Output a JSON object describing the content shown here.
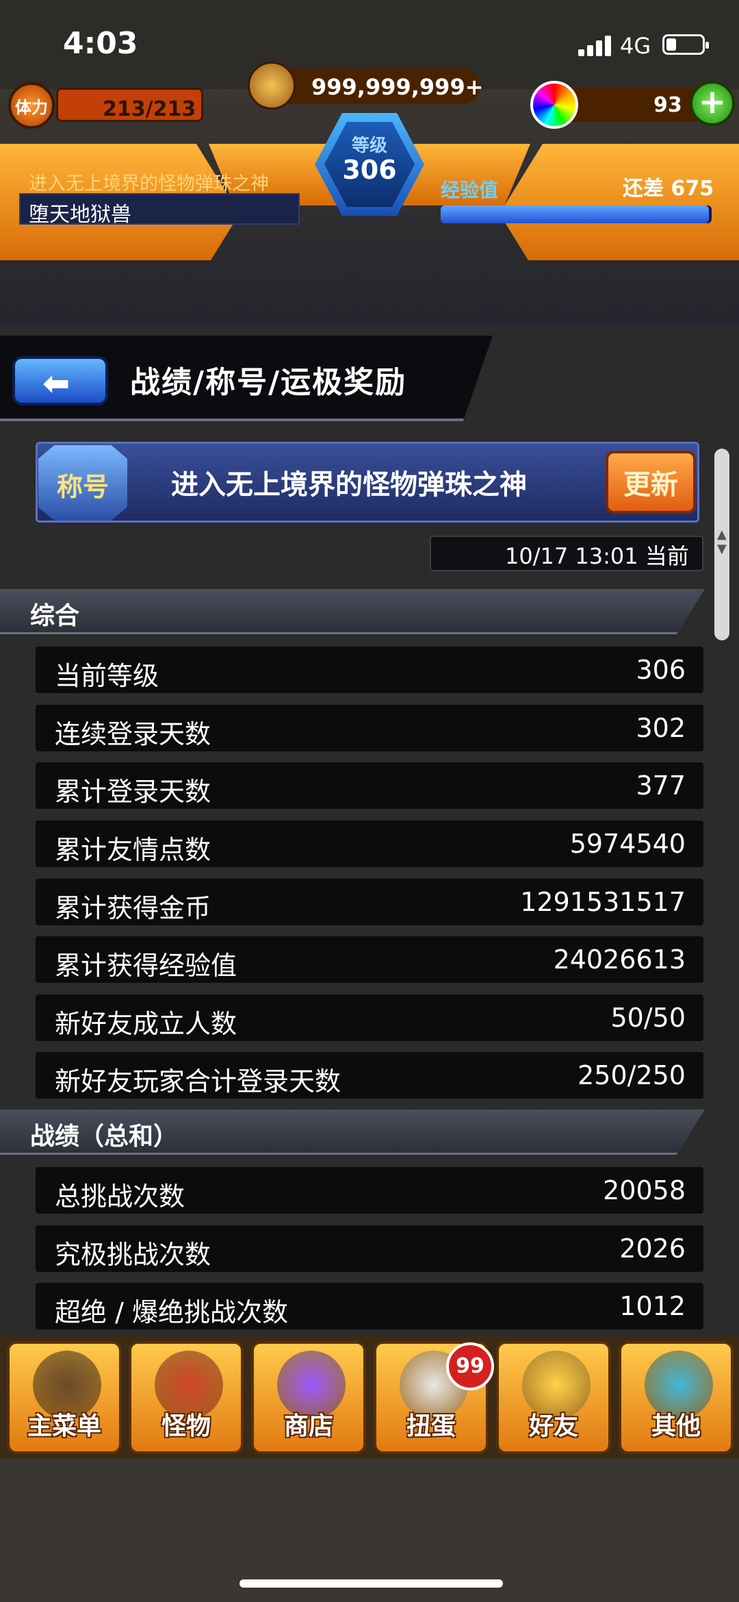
{
  "status_bar": {
    "time": "4:03",
    "network": "4G"
  },
  "hud": {
    "stamina_label": "体力",
    "stamina": "213/213",
    "coins": "999,999,999+",
    "orbs": "93",
    "plus": "+",
    "level_label": "等级",
    "level": "306",
    "player_title": "进入无上境界的怪物弹珠之神",
    "player_name": "堕天地狱兽",
    "exp_label": "经验值",
    "exp_remaining": "还差 675",
    "exp_progress": 0.99
  },
  "header": {
    "back_icon": "back-arrow-icon",
    "title": "战绩/称号/运极奖励"
  },
  "title_card": {
    "badge": "称号",
    "name": "进入无上境界的怪物弹珠之神",
    "update_button": "更新",
    "timestamp": "10/17 13:01 当前"
  },
  "sections": [
    {
      "title": "综合",
      "rows": [
        {
          "label": "当前等级",
          "value": "306"
        },
        {
          "label": "连续登录天数",
          "value": "302"
        },
        {
          "label": "累计登录天数",
          "value": "377"
        },
        {
          "label": "累计友情点数",
          "value": "5974540"
        },
        {
          "label": "累计获得金币",
          "value": "1291531517"
        },
        {
          "label": "累计获得经验值",
          "value": "24026613"
        },
        {
          "label": "新好友成立人数",
          "value": "50/50"
        },
        {
          "label": "新好友玩家合计登录天数",
          "value": "250/250"
        }
      ]
    },
    {
      "title": "战绩（总和）",
      "rows": [
        {
          "label": "总挑战次数",
          "value": "20058"
        },
        {
          "label": "究极挑战次数",
          "value": "2026"
        },
        {
          "label": "超绝 / 爆绝挑战次数",
          "value": "1012"
        }
      ]
    }
  ],
  "bottom_nav": [
    {
      "label": "主菜单",
      "icon": "home-gate-icon",
      "color": "#6b4b2a"
    },
    {
      "label": "怪物",
      "icon": "monster-icon",
      "color": "#d0452a"
    },
    {
      "label": "商店",
      "icon": "rainbow-orb-icon",
      "color": "#9b59ff"
    },
    {
      "label": "扭蛋",
      "icon": "egg-icon",
      "color": "#e8e8e8",
      "badge": "99"
    },
    {
      "label": "好友",
      "icon": "friends-icon",
      "color": "#ffd24a"
    },
    {
      "label": "其他",
      "icon": "question-icon",
      "color": "#3fb8d8"
    }
  ]
}
